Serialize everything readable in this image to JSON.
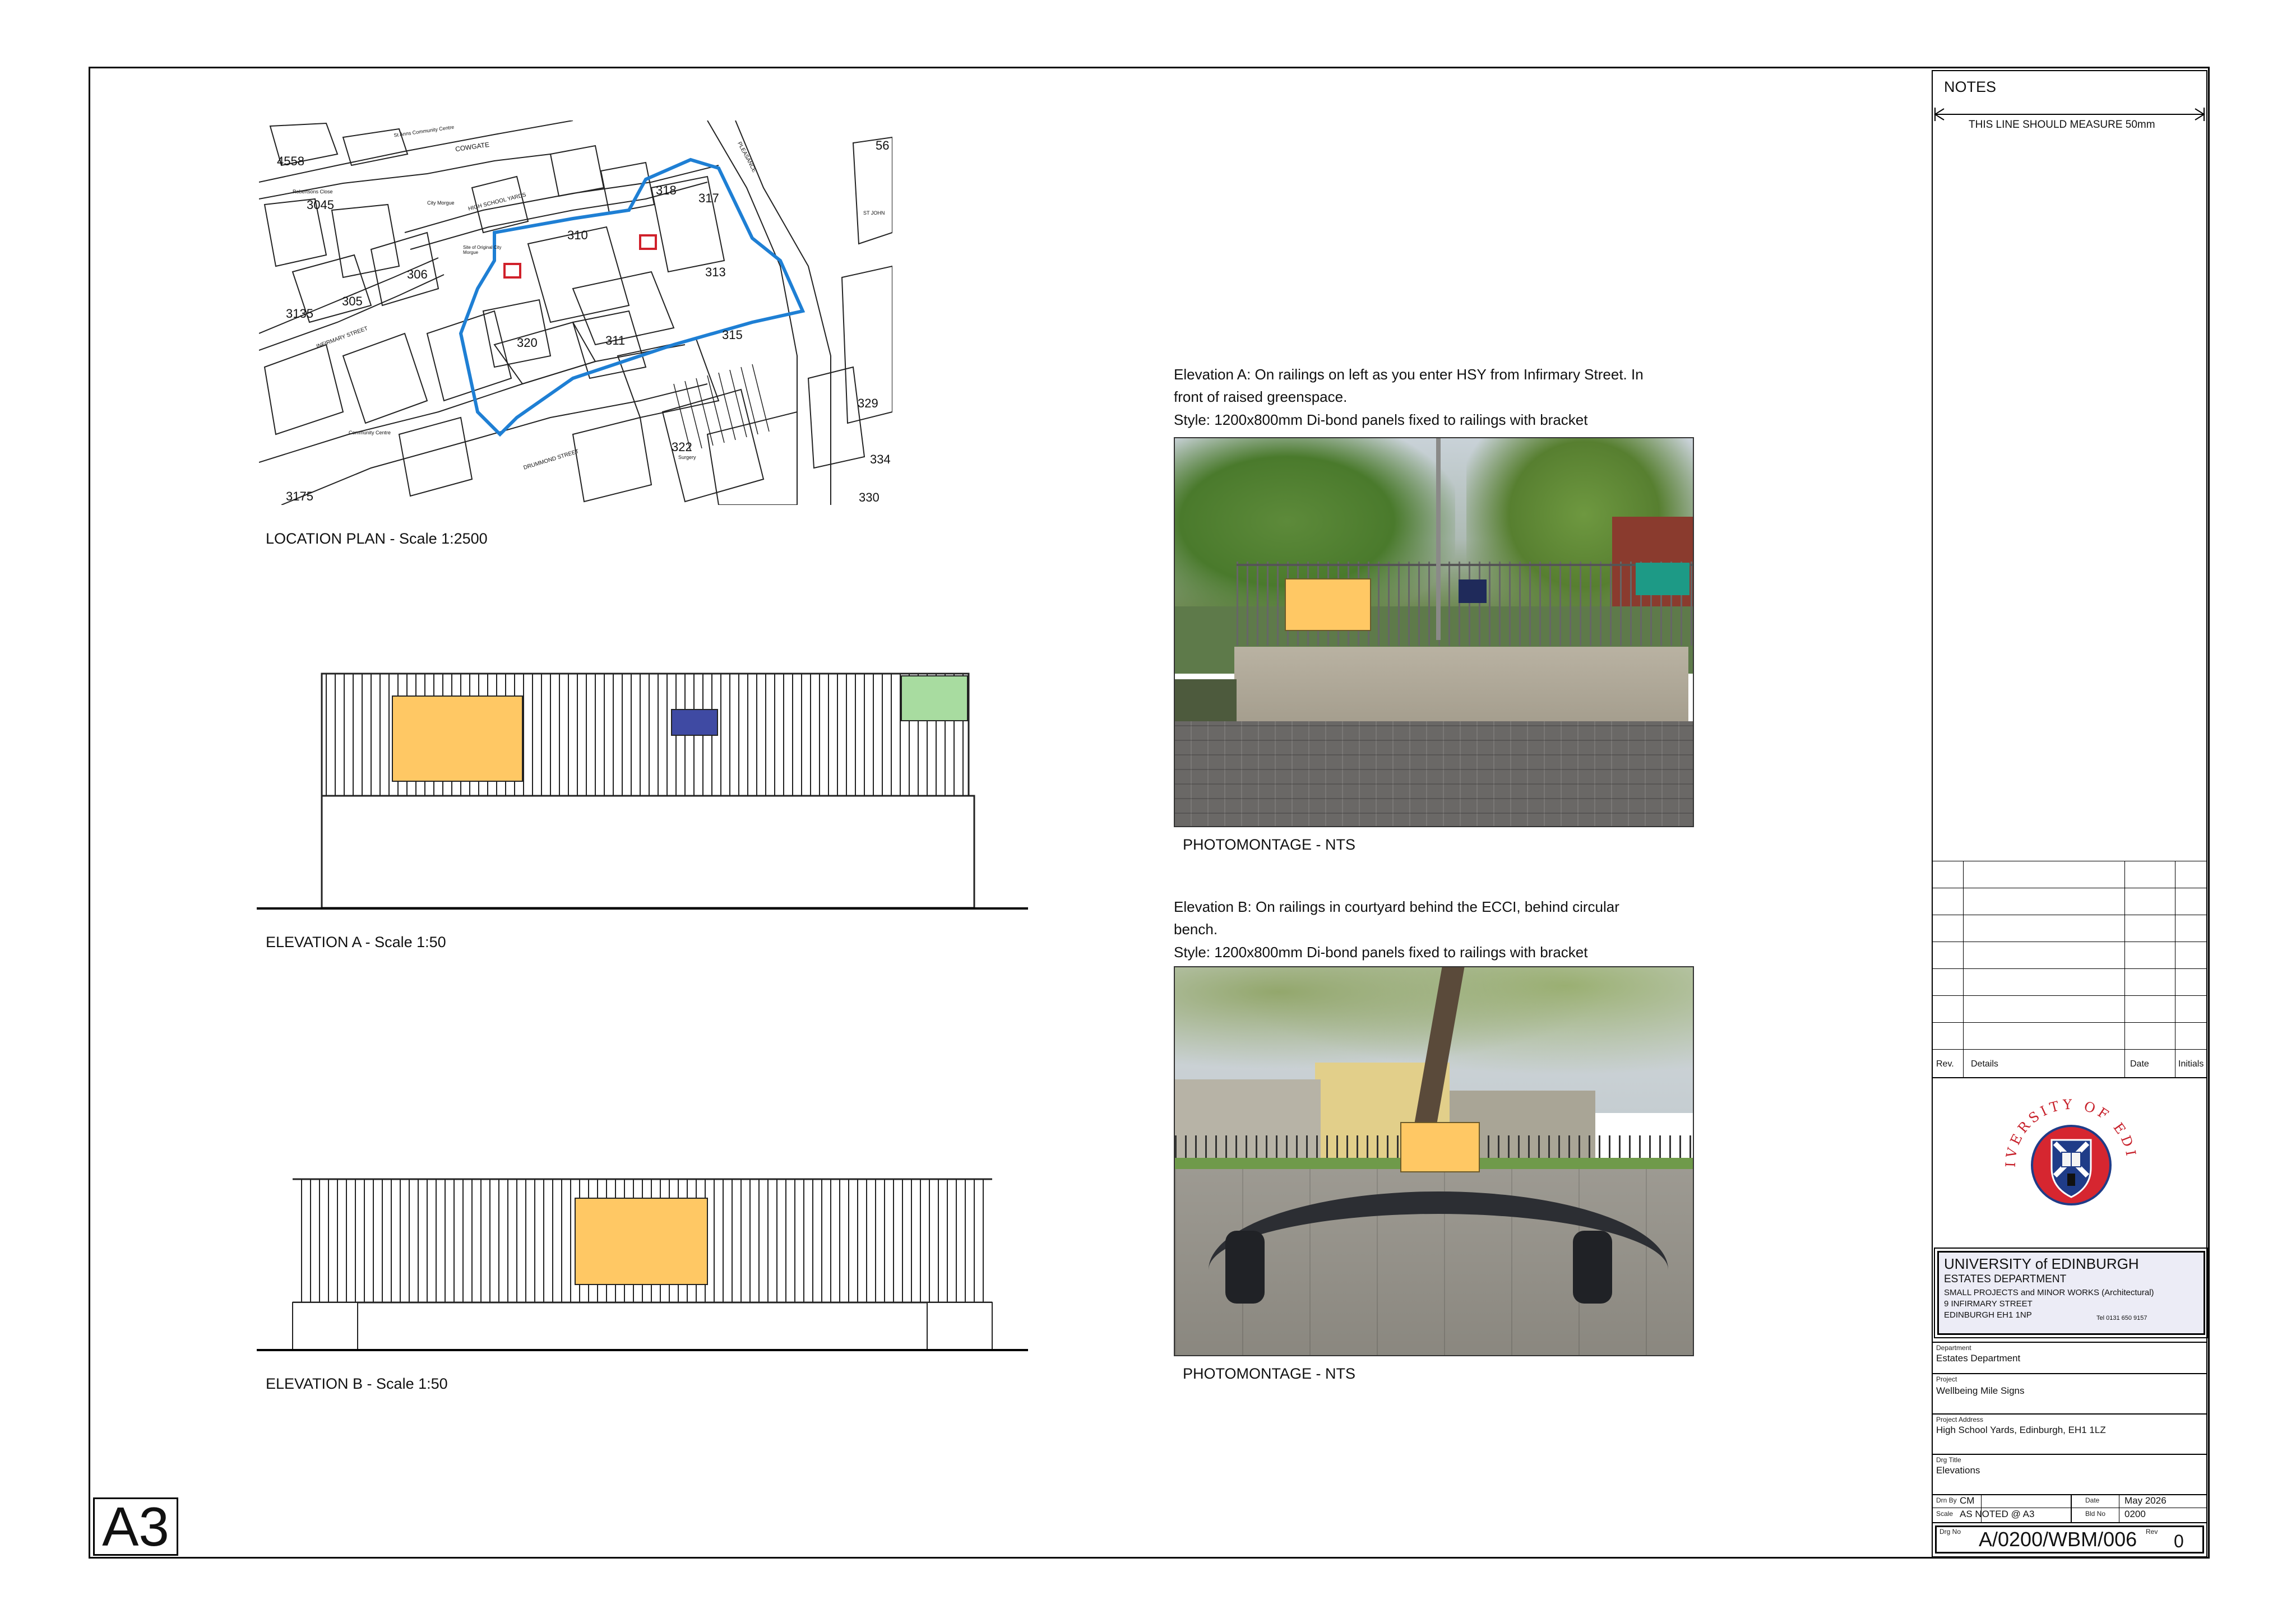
{
  "sheet": {
    "size_mark": "A3"
  },
  "location_plan": {
    "caption": "LOCATION PLAN - Scale 1:2500",
    "map_labels": [
      "4558",
      "3045",
      "3135",
      "305",
      "306",
      "310",
      "311",
      "313",
      "315",
      "317",
      "318",
      "320",
      "322",
      "329",
      "334",
      "330",
      "3175",
      "56",
      "COWGATE",
      "HIGH SCHOOL YARDS",
      "INFIRMARY STREET",
      "PLEASANCE",
      "DRUMMOND STREET",
      "St Anns Community Centre",
      "Community Centre",
      "Robertsons Close",
      "City Morgue",
      "Site of Original City Morgue",
      "ST JOHN",
      "Surgery"
    ],
    "boundary_color": "#1e7fd4",
    "sign_marker_color": "#d0202a"
  },
  "elevation_a": {
    "caption": "ELEVATION A - Scale 1:50",
    "panel_colors": [
      "#ffc864",
      "#3f4aa3",
      "#a8dca0"
    ]
  },
  "elevation_b": {
    "caption": "ELEVATION B - Scale 1:50",
    "panel_color": "#ffc864"
  },
  "photo_a": {
    "description": "Elevation A: On railings on left as you enter HSY from Infirmary Street. In front of raised greenspace.",
    "style": "Style: 1200x800mm Di-bond panels fixed to railings with bracket",
    "caption": "PHOTOMONTAGE - NTS"
  },
  "photo_b": {
    "description": "Elevation B: On railings in courtyard behind the ECCI, behind circular bench.",
    "style": "Style: 1200x800mm Di-bond panels fixed to railings with bracket",
    "caption": "PHOTOMONTAGE - NTS"
  },
  "title_block": {
    "notes_heading": "NOTES",
    "measure_line": "THIS LINE SHOULD MEASURE 50mm",
    "rev_table": {
      "headers": [
        "Rev.",
        "Details",
        "Date",
        "Initials"
      ]
    },
    "crest": {
      "arc_text": "THE UNIVERSITY OF EDINBURGH",
      "ring_color": "#d62630",
      "shield_color": "#1f3c88"
    },
    "address": {
      "org": "UNIVERSITY of EDINBURGH",
      "dept": "ESTATES DEPARTMENT",
      "line1": "SMALL PROJECTS and MINOR WORKS (Architectural)",
      "line2": "9 INFIRMARY STREET",
      "line3": "EDINBURGH EH1 1NP",
      "tel": "Tel 0131 650 9157"
    },
    "department": {
      "label": "Department",
      "value": "Estates Department"
    },
    "project": {
      "label": "Project",
      "value": "Wellbeing Mile Signs"
    },
    "project_address": {
      "label": "Project Address",
      "value": "High School Yards, Edinburgh, EH1 1LZ"
    },
    "drg_title": {
      "label": "Drg Title",
      "value": "Elevations"
    },
    "drn_by": {
      "label": "Drn By",
      "value": "CM"
    },
    "date": {
      "label": "Date",
      "value": "May 2026"
    },
    "scale": {
      "label": "Scale",
      "value": "AS NOTED @ A3"
    },
    "bld_no": {
      "label": "Bld No",
      "value": "0200"
    },
    "drg_no": {
      "label": "Drg No",
      "value": "A/0200/WBM/006"
    },
    "rev": {
      "label": "Rev",
      "value": "0"
    }
  }
}
